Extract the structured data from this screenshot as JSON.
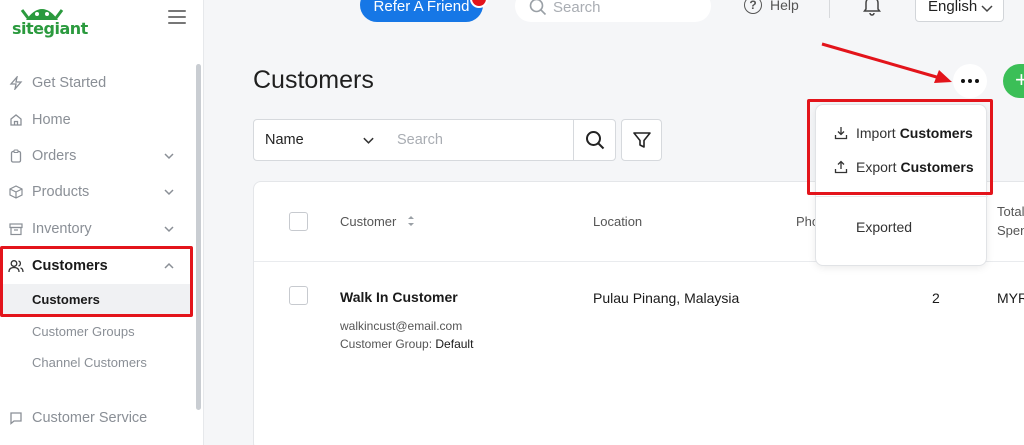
{
  "brand": {
    "logo_text": "sitegiant"
  },
  "topbar": {
    "refer_label": "Refer A Friend",
    "search_placeholder": "Search",
    "help_label": "Help",
    "language": "English"
  },
  "sidebar": {
    "items": [
      {
        "label": "Get Started"
      },
      {
        "label": "Home"
      },
      {
        "label": "Orders"
      },
      {
        "label": "Products"
      },
      {
        "label": "Inventory"
      },
      {
        "label": "Customers"
      },
      {
        "label": "Customer Service"
      }
    ],
    "customers_sub": [
      {
        "label": "Customers"
      },
      {
        "label": "Customer Groups"
      },
      {
        "label": "Channel Customers"
      }
    ]
  },
  "page": {
    "title": "Customers",
    "add_label": "+",
    "filter_field": "Name",
    "filter_placeholder": "Search"
  },
  "table": {
    "headers": {
      "customer": "Customer",
      "location": "Location",
      "phone": "Pho",
      "total_line1": "Total",
      "total_line2": "Spen"
    },
    "rows": [
      {
        "name": "Walk In Customer",
        "email": "walkincust@email.com",
        "group_label": "Customer Group:",
        "group_value": "Default",
        "location": "Pulau Pinang, Malaysia",
        "orders": "2",
        "currency": "MYR"
      }
    ]
  },
  "dropdown": {
    "import_prefix": "Import",
    "import_bold": "Customers",
    "export_prefix": "Export",
    "export_bold": "Customers",
    "exported": "Exported"
  },
  "colors": {
    "accent_blue": "#1677e6",
    "brand_green": "#2b9a3e",
    "add_green": "#3bbf57",
    "highlight_red": "#e3141b"
  }
}
